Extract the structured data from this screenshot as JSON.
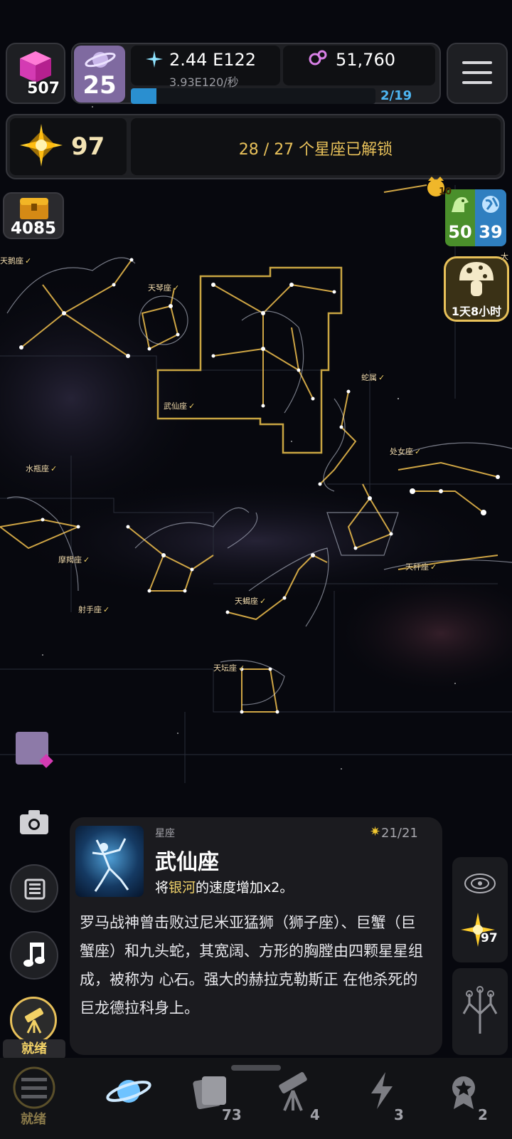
{
  "hud": {
    "cubes": "507",
    "planet_level": "25",
    "energy_value": "2.44",
    "energy_exp": "E122",
    "energy_rate": "3.93E120/秒",
    "dark_matter": "51,760",
    "progress_text": "2/19",
    "progress_fraction": 0.105,
    "stars": "97",
    "unlock_text": "28 / 27 个星座已解锁"
  },
  "side": {
    "chest_count": "4085",
    "badge_crown": "10",
    "badge_creatures": "50",
    "badge_planets": "39",
    "mushroom_timer": "1天8小时",
    "camera_icon": "camera-icon",
    "news_icon": "newspaper-icon",
    "music_icon": "music-note-icon",
    "telescope_label": "就绪",
    "right_stars": "97"
  },
  "constellations": {
    "cygnus": "天鹅座",
    "lyra": "天琴座",
    "hercules": "武仙座",
    "serpens": "蛇属",
    "aquarius": "水瓶座",
    "virgo": "处女座",
    "capricornus": "摩羯座",
    "sagittarius": "射手座",
    "scorpius": "天蝎座",
    "libra": "天秤座",
    "ara": "天坛座",
    "edge_label": "大",
    "check": "✓"
  },
  "card": {
    "category": "星座",
    "progress": "21/21",
    "title": "武仙座",
    "effect_prefix": "将",
    "effect_highlight": "银河",
    "effect_suffix": "的速度增加x2。",
    "description": "罗马战神曾击败过尼米亚猛狮（狮子座）、巨蟹（巨蟹座）和九头蛇，其宽阔、方形的胸膛由四颗星星组成，被称为 心石。强大的赫拉克勒斯正 在他杀死的巨龙德拉科身上。"
  },
  "nav": {
    "ready_label": "就绪",
    "cards_count": "73",
    "telescopes_count": "4",
    "power_count": "3",
    "achievements_count": "2"
  },
  "colors": {
    "accent_gold": "#e8c15a",
    "energy_blue": "#4eb6f2",
    "panel": "#1e1f23"
  }
}
